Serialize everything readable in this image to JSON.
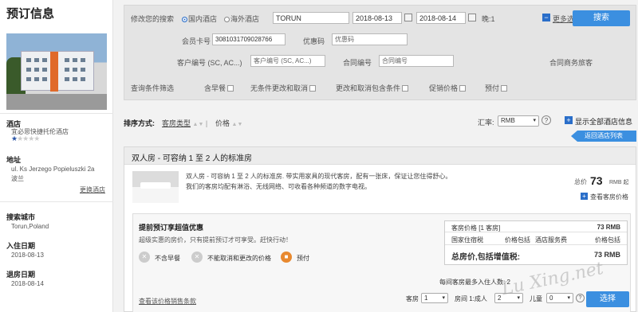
{
  "left": {
    "title": "预订信息",
    "hotel_label": "酒店",
    "hotel_name": "宜必思快捷托伦酒店",
    "address_label": "地址",
    "address_line1": "ul. Ks Jerzego Popieluszki 2a",
    "address_line2": "波兰",
    "change_hotel": "更换酒店",
    "city_label": "搜索城市",
    "city_value": "Torun,Poland",
    "checkin_label": "入住日期",
    "checkin_value": "2018-08-13",
    "checkout_label": "退房日期",
    "checkout_value": "2018-08-14"
  },
  "search": {
    "modify_label": "修改您的搜索",
    "domestic": "国内酒店",
    "overseas": "海外酒店",
    "city": "TORUN",
    "date_in": "2018-08-13",
    "date_out": "2018-08-14",
    "nights": "晚:1",
    "more_options": "更多选择",
    "search_button": "搜索",
    "member_card_label": "会员卡号",
    "member_card_value": "3081031709028766",
    "coupon_label": "优惠码",
    "coupon_placeholder": "优惠码",
    "client_no_label": "客户编号 (SC, AC...)",
    "client_no_placeholder": "客户编号 (SC, AC...)",
    "contract_label": "合同编号",
    "contract_placeholder": "合同编号",
    "contract_traveler": "合同商务旅客",
    "filter_label": "查询条件筛选",
    "filters": [
      "含早餐",
      "无条件更改和取消",
      "更改和取消包含条件",
      "促销价格",
      "预付"
    ]
  },
  "sort": {
    "label": "排序方式:",
    "room_type": "客房类型",
    "price": "价格",
    "rate_label": "汇率:",
    "currency": "RMB",
    "help": "?",
    "show_all": "显示全部酒店信息",
    "back": "返回酒店列表"
  },
  "room": {
    "title": "双人房 - 可容纳 1 至 2 人的标准房",
    "desc1": "双人房 - 可容纳 1 至 2 人的标准房. 带实用家具的现代客房，配有一张床，保证让您住得舒心。",
    "desc2": "我们的客房均配有淋浴、无线网络、可收看各种频道的数字电视。",
    "total_label": "总价",
    "price": "73",
    "price_unit": "RMB 起",
    "view_prices": "查看客房价格"
  },
  "offer": {
    "title": "提前预订享超值优惠",
    "desc": "超级实惠的房价，只有提前预订才可享受。赶快行动！",
    "feature1": "不含早餐",
    "feature2": "不能取消和更改的价格",
    "feature3": "预付",
    "terms": "查看该价格销售条款",
    "table": {
      "row1_label": "客房价格 [1 客房]",
      "row1_value": "73 RMB",
      "row2_c1": "国家住宿税",
      "row2_c2": "价格包括",
      "row2_c3": "酒店服务费",
      "row2_c4": "价格包括",
      "total_label": "总房价,包括增值税:",
      "total_value": "73 RMB"
    },
    "max_guests": "每间客房最多入住人数: 2",
    "rooms_label": "客房",
    "rooms_value": "1",
    "room1_label": "房间 1:成人",
    "adults_value": "2",
    "children_label": "儿童",
    "children_value": "0",
    "select_button": "选择"
  },
  "watermark": "Lu Xing.net",
  "colors": {
    "accent": "#3b8fe0",
    "brand_blue": "#2a6ec9"
  }
}
